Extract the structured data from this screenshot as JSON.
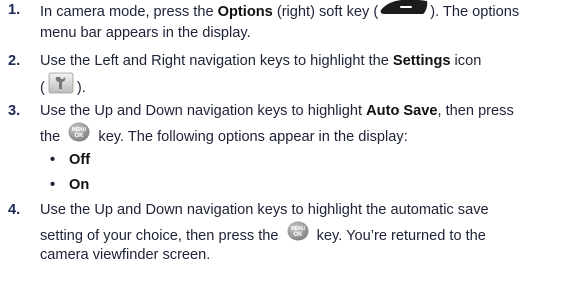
{
  "steps": [
    {
      "number": "1.",
      "lines": [
        [
          "In camera mode, press the ",
          "Options",
          " (right) soft key (",
          "). The options"
        ],
        [
          "menu bar appears in the display."
        ]
      ]
    },
    {
      "number": "2.",
      "lines": [
        [
          "Use the Left and Right navigation keys to highlight the ",
          "Settings",
          " icon"
        ],
        [
          "(",
          ")."
        ]
      ]
    },
    {
      "number": "3.",
      "lines": [
        [
          "Use the Up and Down navigation keys to highlight ",
          "Auto Save",
          ", then press"
        ],
        [
          "the ",
          " key. The following options appear in the display:"
        ]
      ],
      "options": [
        "Off",
        "On"
      ]
    },
    {
      "number": "4.",
      "lines": [
        [
          "Use the Up and Down navigation keys to highlight the automatic save"
        ],
        [
          "setting of your choice, then press the ",
          " key. You’re returned to the"
        ],
        [
          "camera viewfinder screen."
        ]
      ]
    }
  ],
  "icons": {
    "soft_key": "right-soft-key-icon",
    "settings": "settings-icon",
    "menu_ok": "menu-ok-key-icon",
    "menu_ok_text_top": "MENU",
    "menu_ok_text_bottom": "OK"
  },
  "colors": {
    "text": "#1e2236",
    "number": "#1e2a55"
  }
}
